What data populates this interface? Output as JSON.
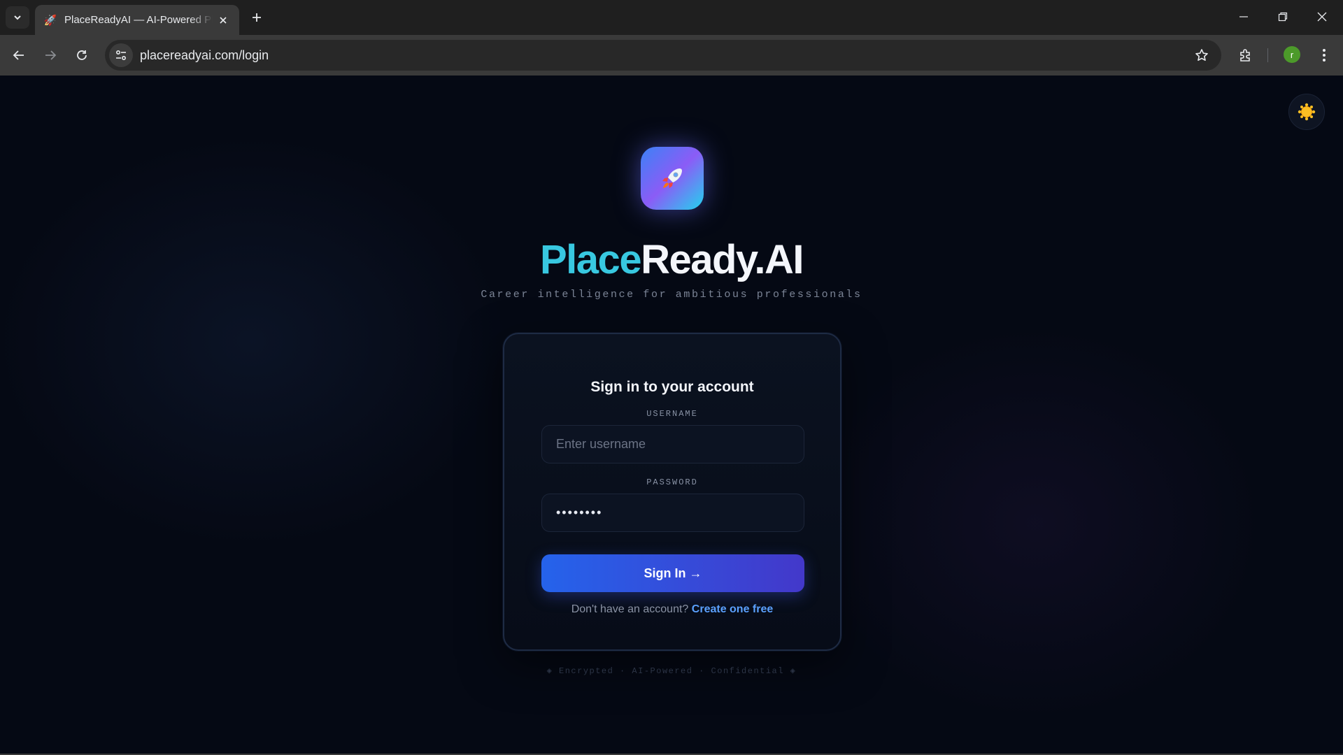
{
  "browser": {
    "tab_title": "PlaceReadyAI — AI-Powered Pl",
    "url": "placereadyai.com/login",
    "profile_initial": "r"
  },
  "page": {
    "brand_part1": "Place",
    "brand_part2": "Ready.AI",
    "tagline": "Career intelligence for ambitious professionals",
    "card": {
      "title": "Sign in to your account",
      "username_label": "USERNAME",
      "username_placeholder": "Enter username",
      "username_value": "",
      "password_label": "PASSWORD",
      "password_value": "••••••••",
      "signin_label": "Sign In →",
      "signup_prompt": "Don't have an account?",
      "signup_link": "Create one free"
    },
    "footer_note": "◈ Encrypted · AI-Powered · Confidential ◈"
  },
  "colors": {
    "accent_blue": "#2563eb",
    "accent_indigo": "#4338ca",
    "brand_cyan": "#38c8e0",
    "link": "#5ba1ff",
    "page_bg": "#050914"
  },
  "icons": {
    "tab_favicon": "rocket-icon",
    "theme_toggle": "sun-icon",
    "logo": "rocket-icon"
  }
}
